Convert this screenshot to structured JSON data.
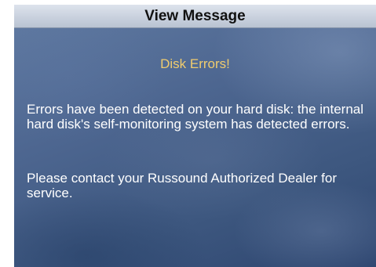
{
  "dialog": {
    "title": "View Message",
    "heading": "Disk Errors!",
    "paragraphs": [
      "Errors have been detected on your hard disk: the internal hard disk's self-monitoring system has detected errors.",
      "Please contact your Russound Authorized Dealer for service."
    ]
  },
  "colors": {
    "title_bar": "#c9d1de",
    "background": "#4d6690",
    "heading_text": "#f0cc6e",
    "body_text": "#ffffff"
  }
}
